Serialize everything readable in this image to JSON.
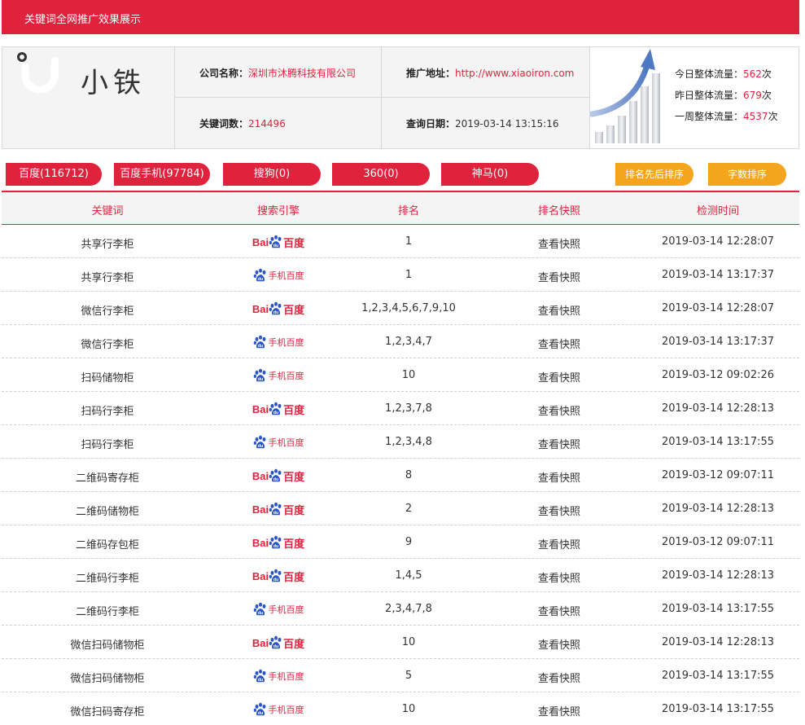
{
  "header": {
    "title": "关键词全网推广效果展示"
  },
  "brand": {
    "name": "小铁"
  },
  "company": {
    "name_label": "公司名称：",
    "name_value": "深圳市沐腾科技有限公司",
    "url_label": "推广地址：",
    "url_value": "http://www.xiaoiron.com",
    "kw_label": "关键词数：",
    "kw_value": "214496",
    "date_label": "查询日期：",
    "date_value": "2019-03-14 13:15:16"
  },
  "traffic": {
    "today_label": "今日整体流量：",
    "today_value": "562",
    "today_unit": "次",
    "yesterday_label": "昨日整体流量：",
    "yesterday_value": "679",
    "yesterday_unit": "次",
    "week_label": "一周整体流量：",
    "week_value": "4537",
    "week_unit": "次"
  },
  "tabs": [
    {
      "label": "百度(116712)"
    },
    {
      "label": "百度手机(97784)"
    },
    {
      "label": "搜狗(0)"
    },
    {
      "label": "360(0)"
    },
    {
      "label": "神马(0)"
    }
  ],
  "sort_buttons": [
    {
      "label": "排名先后排序"
    },
    {
      "label": "字数排序"
    }
  ],
  "table": {
    "headers": [
      "关键词",
      "搜索引擎",
      "排名",
      "排名快照",
      "检测时间"
    ],
    "engine_pc": {
      "bai": "Bai",
      "du": "百度"
    },
    "engine_mobile": {
      "txt": "手机百度"
    },
    "snapshot_label": "查看快照",
    "rows": [
      {
        "keyword": "共享行李柜",
        "engine": "pc",
        "rank": "1",
        "time": "2019-03-14 12:28:07"
      },
      {
        "keyword": "共享行李柜",
        "engine": "mobile",
        "rank": "1",
        "time": "2019-03-14 13:17:37"
      },
      {
        "keyword": "微信行李柜",
        "engine": "pc",
        "rank": "1,2,3,4,5,6,7,9,10",
        "time": "2019-03-14 12:28:07"
      },
      {
        "keyword": "微信行李柜",
        "engine": "mobile",
        "rank": "1,2,3,4,7",
        "time": "2019-03-14 13:17:37"
      },
      {
        "keyword": "扫码储物柜",
        "engine": "mobile",
        "rank": "10",
        "time": "2019-03-12 09:02:26"
      },
      {
        "keyword": "扫码行李柜",
        "engine": "pc",
        "rank": "1,2,3,7,8",
        "time": "2019-03-14 12:28:13"
      },
      {
        "keyword": "扫码行李柜",
        "engine": "mobile",
        "rank": "1,2,3,4,8",
        "time": "2019-03-14 13:17:55"
      },
      {
        "keyword": "二维码寄存柜",
        "engine": "pc",
        "rank": "8",
        "time": "2019-03-12 09:07:11"
      },
      {
        "keyword": "二维码储物柜",
        "engine": "pc",
        "rank": "2",
        "time": "2019-03-14 12:28:13"
      },
      {
        "keyword": "二维码存包柜",
        "engine": "pc",
        "rank": "9",
        "time": "2019-03-12 09:07:11"
      },
      {
        "keyword": "二维码行李柜",
        "engine": "pc",
        "rank": "1,4,5",
        "time": "2019-03-14 12:28:13"
      },
      {
        "keyword": "二维码行李柜",
        "engine": "mobile",
        "rank": "2,3,4,7,8",
        "time": "2019-03-14 13:17:55"
      },
      {
        "keyword": "微信扫码储物柜",
        "engine": "pc",
        "rank": "10",
        "time": "2019-03-14 12:28:13"
      },
      {
        "keyword": "微信扫码储物柜",
        "engine": "mobile",
        "rank": "5",
        "time": "2019-03-14 13:17:55"
      },
      {
        "keyword": "微信扫码寄存柜",
        "engine": "mobile",
        "rank": "10",
        "time": "2019-03-14 13:17:55"
      }
    ]
  },
  "colors": {
    "accent": "#e0233d",
    "sort": "#f5a51b"
  }
}
